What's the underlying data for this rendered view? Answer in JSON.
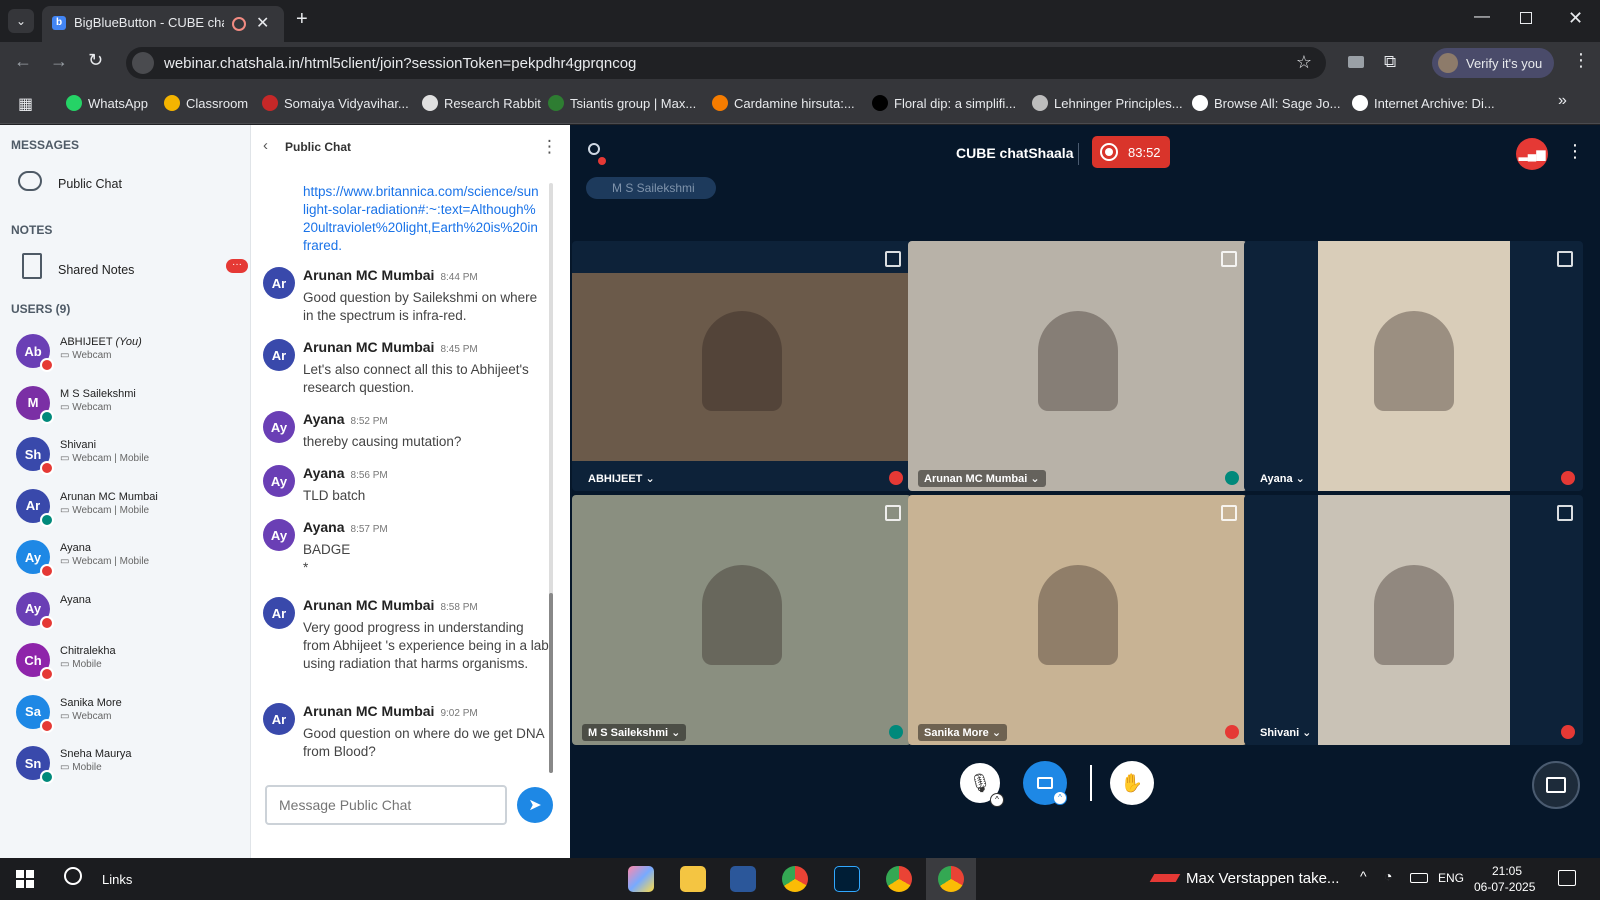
{
  "browser": {
    "tab_title": "BigBlueButton - CUBE chatS",
    "url": "webinar.chatshala.in/html5client/join?sessionToken=pekpdhr4gprqncog",
    "verify_label": "Verify it's you",
    "bookmarks": [
      {
        "label": "WhatsApp",
        "color": "#25d366"
      },
      {
        "label": "Classroom",
        "color": "#f4b400"
      },
      {
        "label": "Somaiya Vidyavihar...",
        "color": "#c62828"
      },
      {
        "label": "Research Rabbit",
        "color": "#e0e0e0"
      },
      {
        "label": "Tsiantis group | Max...",
        "color": "#2e7d32"
      },
      {
        "label": "Cardamine hirsuta:...",
        "color": "#f57c00"
      },
      {
        "label": "Floral dip: a simplifi...",
        "color": "#000000"
      },
      {
        "label": "Lehninger Principles...",
        "color": "#bdbdbd"
      },
      {
        "label": "Browse All: Sage Jo...",
        "color": "#ffffff"
      },
      {
        "label": "Internet Archive: Di...",
        "color": "#ffffff"
      }
    ]
  },
  "sidebar": {
    "messages_title": "MESSAGES",
    "public_chat_label": "Public Chat",
    "notes_title": "NOTES",
    "shared_notes_label": "Shared Notes",
    "shared_notes_badge": "···",
    "users_title": "USERS (9)",
    "users": [
      {
        "initials": "Ab",
        "name": "ABHIJEET",
        "you": "(You)",
        "sub": "Webcam",
        "color": "#6a3fb5",
        "badge": "#e53935"
      },
      {
        "initials": "M",
        "name": "M S Sailekshmi",
        "you": "",
        "sub": "Webcam",
        "color": "#7b2fa5",
        "badge": "#00897b"
      },
      {
        "initials": "Sh",
        "name": "Shivani",
        "you": "",
        "sub": "Webcam | Mobile",
        "color": "#3949ab",
        "badge": "#e53935"
      },
      {
        "initials": "Ar",
        "name": "Arunan MC Mumbai",
        "you": "",
        "sub": "Webcam | Mobile",
        "color": "#3949ab",
        "badge": "#00897b"
      },
      {
        "initials": "Ay",
        "name": "Ayana",
        "you": "",
        "sub": "Webcam | Mobile",
        "color": "#1e88e5",
        "badge": "#e53935"
      },
      {
        "initials": "Ay",
        "name": "Ayana",
        "you": "",
        "sub": "",
        "color": "#6a3fb5",
        "badge": "#e53935"
      },
      {
        "initials": "Ch",
        "name": "Chitralekha",
        "you": "",
        "sub": "Mobile",
        "color": "#8e24aa",
        "badge": "#e53935"
      },
      {
        "initials": "Sa",
        "name": "Sanika More",
        "you": "",
        "sub": "Webcam",
        "color": "#1e88e5",
        "badge": "#e53935"
      },
      {
        "initials": "Sn",
        "name": "Sneha Maurya",
        "you": "",
        "sub": "Mobile",
        "color": "#3949ab",
        "badge": "#00897b"
      }
    ]
  },
  "chat": {
    "header": "Public Chat",
    "link_text": "https://www.britannica.com/science/sunlight-solar-radiation#:~:text=Although%20ultraviolet%20light,Earth%20is%20infrared.",
    "messages": [
      {
        "initials": "Ar",
        "author": "Arunan MC Mumbai",
        "time": "8:44 PM",
        "text": "Good question by Sailekshmi on where in the spectrum is infra-red.",
        "color": "#3949ab"
      },
      {
        "initials": "Ar",
        "author": "Arunan MC Mumbai",
        "time": "8:45 PM",
        "text": "Let's also connect all this to Abhijeet's research question.",
        "color": "#3949ab"
      },
      {
        "initials": "Ay",
        "author": "Ayana",
        "time": "8:52 PM",
        "text": "thereby causing mutation?",
        "color": "#6a3fb5"
      },
      {
        "initials": "Ay",
        "author": "Ayana",
        "time": "8:56 PM",
        "text": "TLD batch",
        "color": "#6a3fb5"
      },
      {
        "initials": "Ay",
        "author": "Ayana",
        "time": "8:57 PM",
        "text": "BADGE\n*",
        "color": "#6a3fb5"
      },
      {
        "initials": "Ar",
        "author": "Arunan MC Mumbai",
        "time": "8:58 PM",
        "text": "Very good progress in understanding from Abhijeet 's experience being in a lab using radiation that harms organisms.",
        "color": "#3949ab"
      },
      {
        "initials": "Ar",
        "author": "Arunan MC Mumbai",
        "time": "9:02 PM",
        "text": "Good question on where do we get DNA from Blood?",
        "color": "#3949ab"
      }
    ],
    "input_placeholder": "Message Public Chat"
  },
  "meeting": {
    "title": "CUBE chatShaala",
    "timer": "83:52",
    "talking": "M S Sailekshmi",
    "tiles": [
      {
        "name": "ABHIJEET",
        "bg": "#6b5a4a"
      },
      {
        "name": "Arunan MC Mumbai",
        "bg": "#b8b2a8"
      },
      {
        "name": "Ayana",
        "bg": "#d9cdb9"
      },
      {
        "name": "M S Sailekshmi",
        "bg": "#8a8f80"
      },
      {
        "name": "Sanika More",
        "bg": "#c8b394"
      },
      {
        "name": "Shivani",
        "bg": "#c9c2b6"
      }
    ]
  },
  "taskbar": {
    "search_label": "Links",
    "news": "Max Verstappen take...",
    "lang": "ENG",
    "time": "21:05",
    "date": "06-07-2025"
  }
}
